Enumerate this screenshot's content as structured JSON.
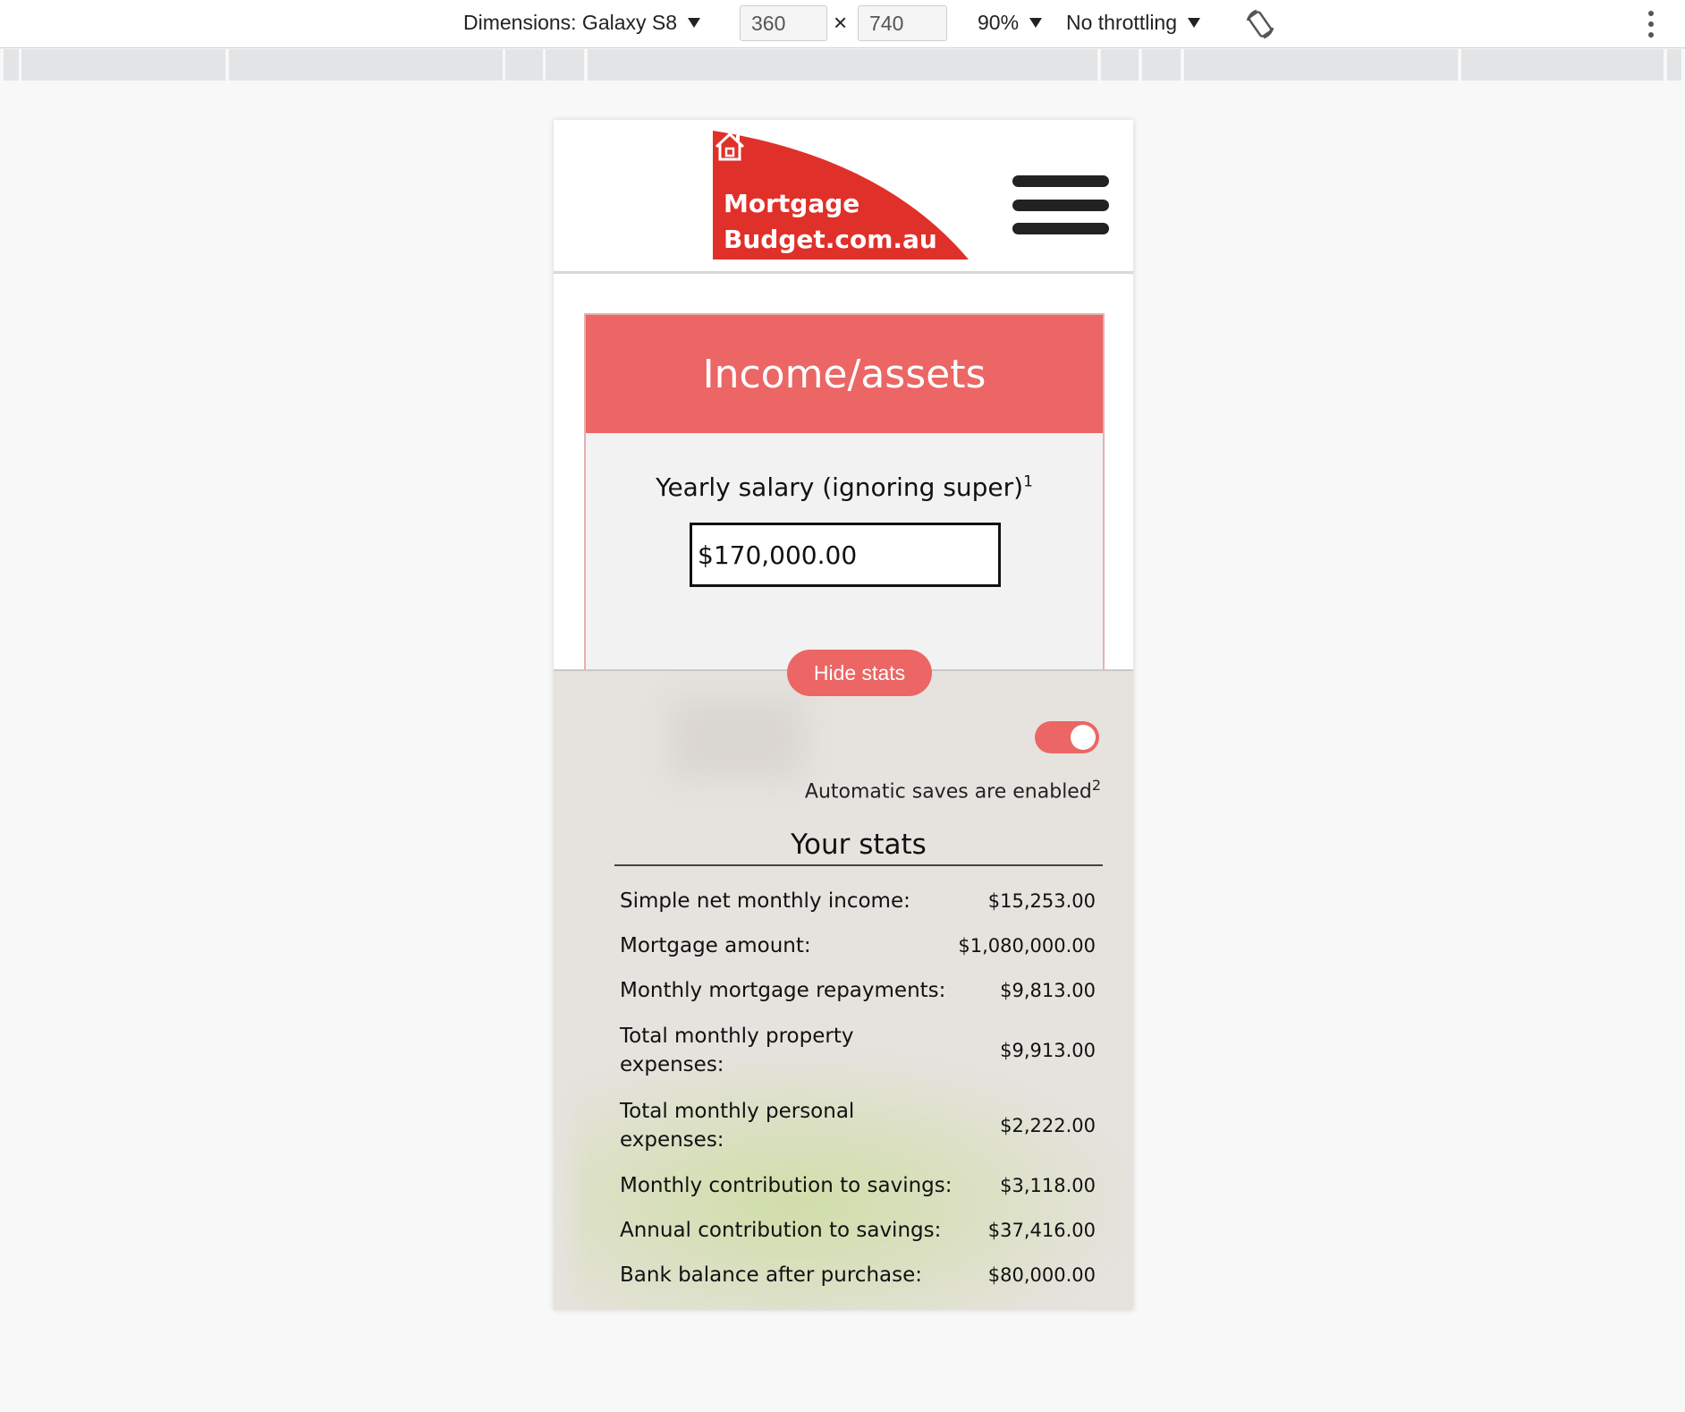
{
  "devtools": {
    "dimensions_label": "Dimensions: Galaxy S8",
    "width_value": "360",
    "times": "×",
    "height_value": "740",
    "zoom": "90%",
    "throttling": "No throttling"
  },
  "header": {
    "logo_line1": "Mortgage",
    "logo_line2": "Budget.com.au"
  },
  "income": {
    "title": "Income/assets",
    "salary_label": "Yearly salary (ignoring super)",
    "salary_footnote": "1",
    "salary_value": "$170,000.00"
  },
  "stats": {
    "hide_button": "Hide stats",
    "autosave_text": "Automatic saves are enabled",
    "autosave_footnote": "2",
    "autosave_enabled": true,
    "title": "Your stats",
    "rows": [
      {
        "label": "Simple net monthly income:",
        "value": "$15,253.00"
      },
      {
        "label": "Mortgage amount:",
        "value": "$1,080,000.00"
      },
      {
        "label": "Monthly mortgage repayments:",
        "value": "$9,813.00"
      },
      {
        "label": "Total monthly property expenses:",
        "value": "$9,913.00"
      },
      {
        "label": "Total monthly personal expenses:",
        "value": "$2,222.00"
      },
      {
        "label": "Monthly contribution to savings:",
        "value": "$3,118.00"
      },
      {
        "label": "Annual contribution to savings:",
        "value": "$37,416.00"
      },
      {
        "label": "Bank balance after purchase:",
        "value": "$80,000.00"
      }
    ]
  },
  "colors": {
    "brand_red": "#e0302a",
    "accent_coral": "#eb6664"
  }
}
